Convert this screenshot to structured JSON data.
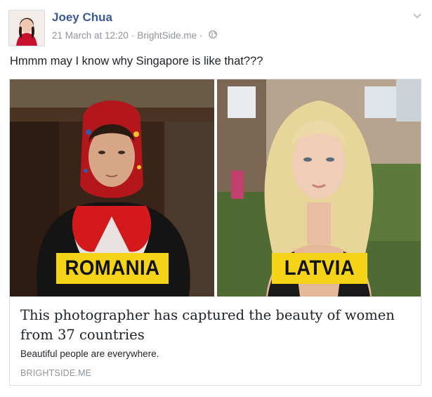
{
  "post": {
    "author": "Joey Chua",
    "timestamp": "21 March at 12:20",
    "separator": "·",
    "via": "BrightSide.me",
    "privacy_icon": "globe-icon",
    "options_icon": "chevron-down-icon",
    "message": "Hmmm may I know why Singapore is like that???"
  },
  "card": {
    "left_label": "ROMANIA",
    "right_label": "LATVIA",
    "title": "This photographer has captured the beauty of women from 37 countries",
    "description": "Beautiful people are everywhere.",
    "domain": "BRIGHTSIDE.ME"
  },
  "colors": {
    "author_link": "#3b5998",
    "meta_text": "#90949c",
    "label_yellow": "#f5d316",
    "body_text": "#1d2129"
  }
}
